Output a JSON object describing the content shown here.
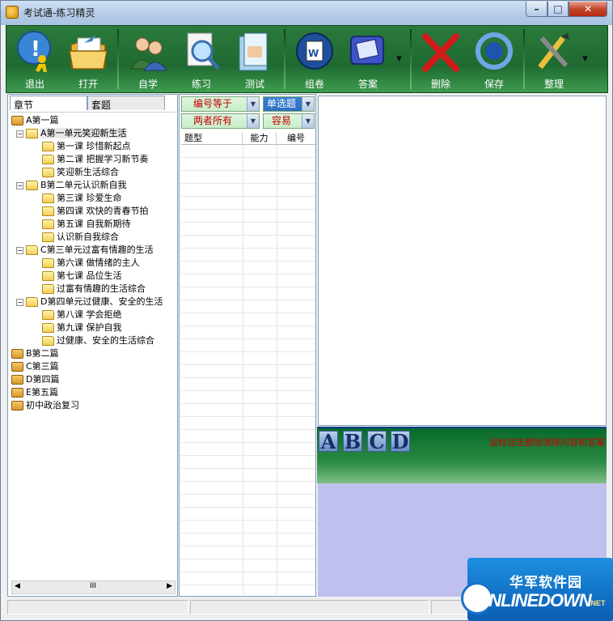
{
  "window": {
    "title": "考试通-练习精灵"
  },
  "toolbar": {
    "buttons": [
      {
        "label": "退出",
        "icon": "exit-icon"
      },
      {
        "label": "打开",
        "icon": "open-folder-icon"
      },
      {
        "label": "自学",
        "icon": "self-study-icon"
      },
      {
        "label": "练习",
        "icon": "practice-icon"
      },
      {
        "label": "测试",
        "icon": "test-icon"
      },
      {
        "label": "组卷",
        "icon": "compose-paper-icon"
      },
      {
        "label": "答案",
        "icon": "answer-icon"
      },
      {
        "label": "删除",
        "icon": "delete-icon"
      },
      {
        "label": "保存",
        "icon": "save-icon"
      },
      {
        "label": "整理",
        "icon": "organize-icon"
      }
    ]
  },
  "left_panel": {
    "tabs": [
      "章节",
      "套题"
    ],
    "tree": [
      {
        "label": "A第一篇",
        "level": 0,
        "icon": "book"
      },
      {
        "label": "A第一单元笑迎新生活",
        "level": 1,
        "icon": "folder-check",
        "selected": true
      },
      {
        "label": "第一课 珍惜新起点",
        "level": 2,
        "icon": "folder"
      },
      {
        "label": "第二课 把握学习新节奏",
        "level": 2,
        "icon": "folder"
      },
      {
        "label": "笑迎新生活综合",
        "level": 2,
        "icon": "folder"
      },
      {
        "label": "B第二单元认识新自我",
        "level": 1,
        "icon": "folder-note"
      },
      {
        "label": "第三课 珍爱生命",
        "level": 2,
        "icon": "folder"
      },
      {
        "label": "第四课 欢快的青春节拍",
        "level": 2,
        "icon": "folder"
      },
      {
        "label": "第五课 自我新期待",
        "level": 2,
        "icon": "folder"
      },
      {
        "label": "认识新自我综合",
        "level": 2,
        "icon": "folder"
      },
      {
        "label": "C第三单元过富有情趣的生活",
        "level": 1,
        "icon": "folder-note"
      },
      {
        "label": "第六课 做情绪的主人",
        "level": 2,
        "icon": "folder"
      },
      {
        "label": "第七课 品位生活",
        "level": 2,
        "icon": "folder"
      },
      {
        "label": "过富有情趣的生活综合",
        "level": 2,
        "icon": "folder"
      },
      {
        "label": "D第四单元过健康、安全的生活",
        "level": 1,
        "icon": "folder-note"
      },
      {
        "label": "第八课 学会拒绝",
        "level": 2,
        "icon": "folder"
      },
      {
        "label": "第九课 保护自我",
        "level": 2,
        "icon": "folder"
      },
      {
        "label": "过健康、安全的生活综合",
        "level": 2,
        "icon": "folder"
      },
      {
        "label": "B第二篇",
        "level": 0,
        "icon": "book"
      },
      {
        "label": "C第三篇",
        "level": 0,
        "icon": "book"
      },
      {
        "label": "D第四篇",
        "level": 0,
        "icon": "book"
      },
      {
        "label": "E第五篇",
        "level": 0,
        "icon": "book"
      },
      {
        "label": "初中政治复习",
        "level": 0,
        "icon": "book"
      }
    ],
    "scroll_text": "III"
  },
  "middle_panel": {
    "filter_number": "编号等于",
    "filter_type": "单选题",
    "filter_owner": "两者所有",
    "filter_difficulty": "容易",
    "columns": [
      "题型",
      "能力",
      "编号"
    ]
  },
  "answer_bar": {
    "options": [
      "A",
      "B",
      "C",
      "D"
    ],
    "tip": "鼠标双击删除清除内容和答案"
  },
  "watermark": {
    "cn": "华军软件园",
    "en": "ONLINEDOWN",
    "suffix": ".NET"
  }
}
